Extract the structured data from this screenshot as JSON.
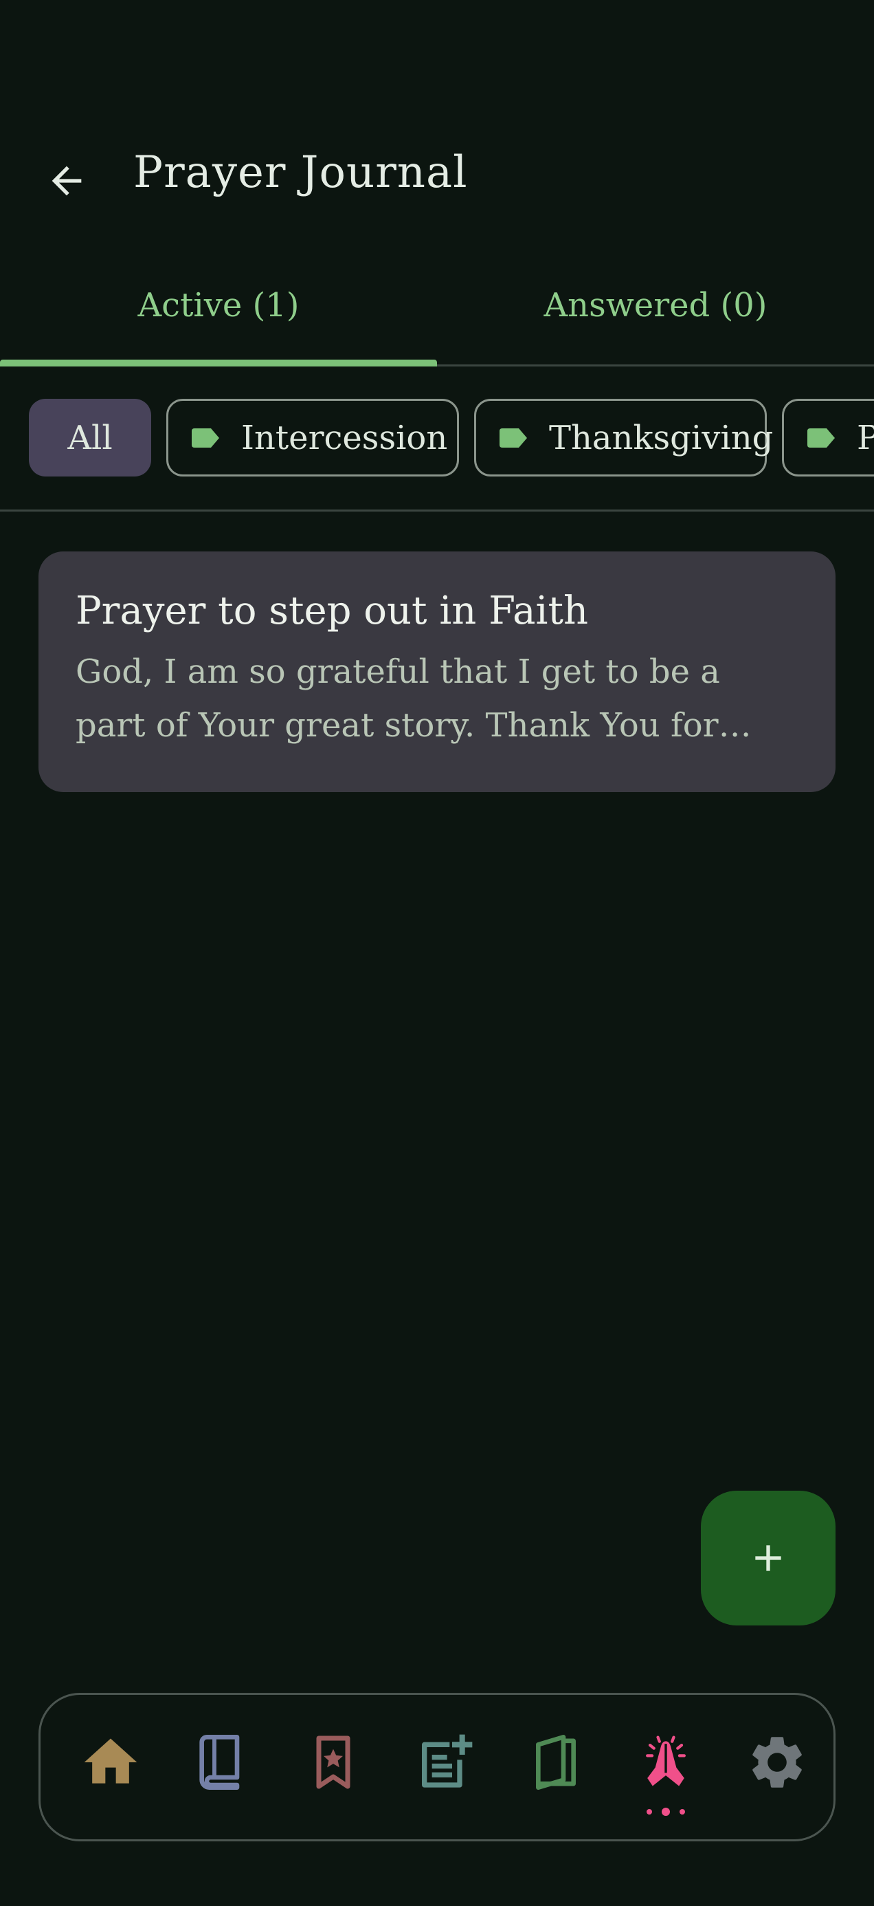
{
  "header": {
    "title": "Prayer Journal",
    "back_icon": "arrow-left-icon"
  },
  "tabs": [
    {
      "label": "Active (1)",
      "selected": true
    },
    {
      "label": "Answered (0)",
      "selected": false
    }
  ],
  "filters": {
    "chips": [
      {
        "label": "All",
        "selected": true
      },
      {
        "label": "Intercession",
        "icon": "tag-icon"
      },
      {
        "label": "Thanksgiving",
        "icon": "tag-icon"
      },
      {
        "label": "Pe",
        "icon": "tag-icon"
      }
    ]
  },
  "prayers": [
    {
      "title": "Prayer to step out in Faith",
      "body": "God, I am so grateful that I get to be a part of Your great story. Thank You for having a p…"
    }
  ],
  "fab": {
    "icon": "plus-icon"
  },
  "nav": {
    "items": [
      {
        "icon": "home-icon",
        "color": "#a88a55"
      },
      {
        "icon": "book-icon",
        "color": "#7480a8"
      },
      {
        "icon": "bookmark-star-icon",
        "color": "#9a5c5c"
      },
      {
        "icon": "note-add-icon",
        "color": "#5d8c86"
      },
      {
        "icon": "open-book-icon",
        "color": "#4f8a55"
      },
      {
        "icon": "praying-hands-icon",
        "color": "#f0508a",
        "selected": true
      },
      {
        "icon": "gear-icon",
        "color": "#6f767a"
      }
    ]
  },
  "colors": {
    "background": "#0c1510",
    "accent": "#7cc178",
    "card": "#3a3941",
    "fab": "#1d5c20",
    "selected_chip": "#48435a"
  }
}
